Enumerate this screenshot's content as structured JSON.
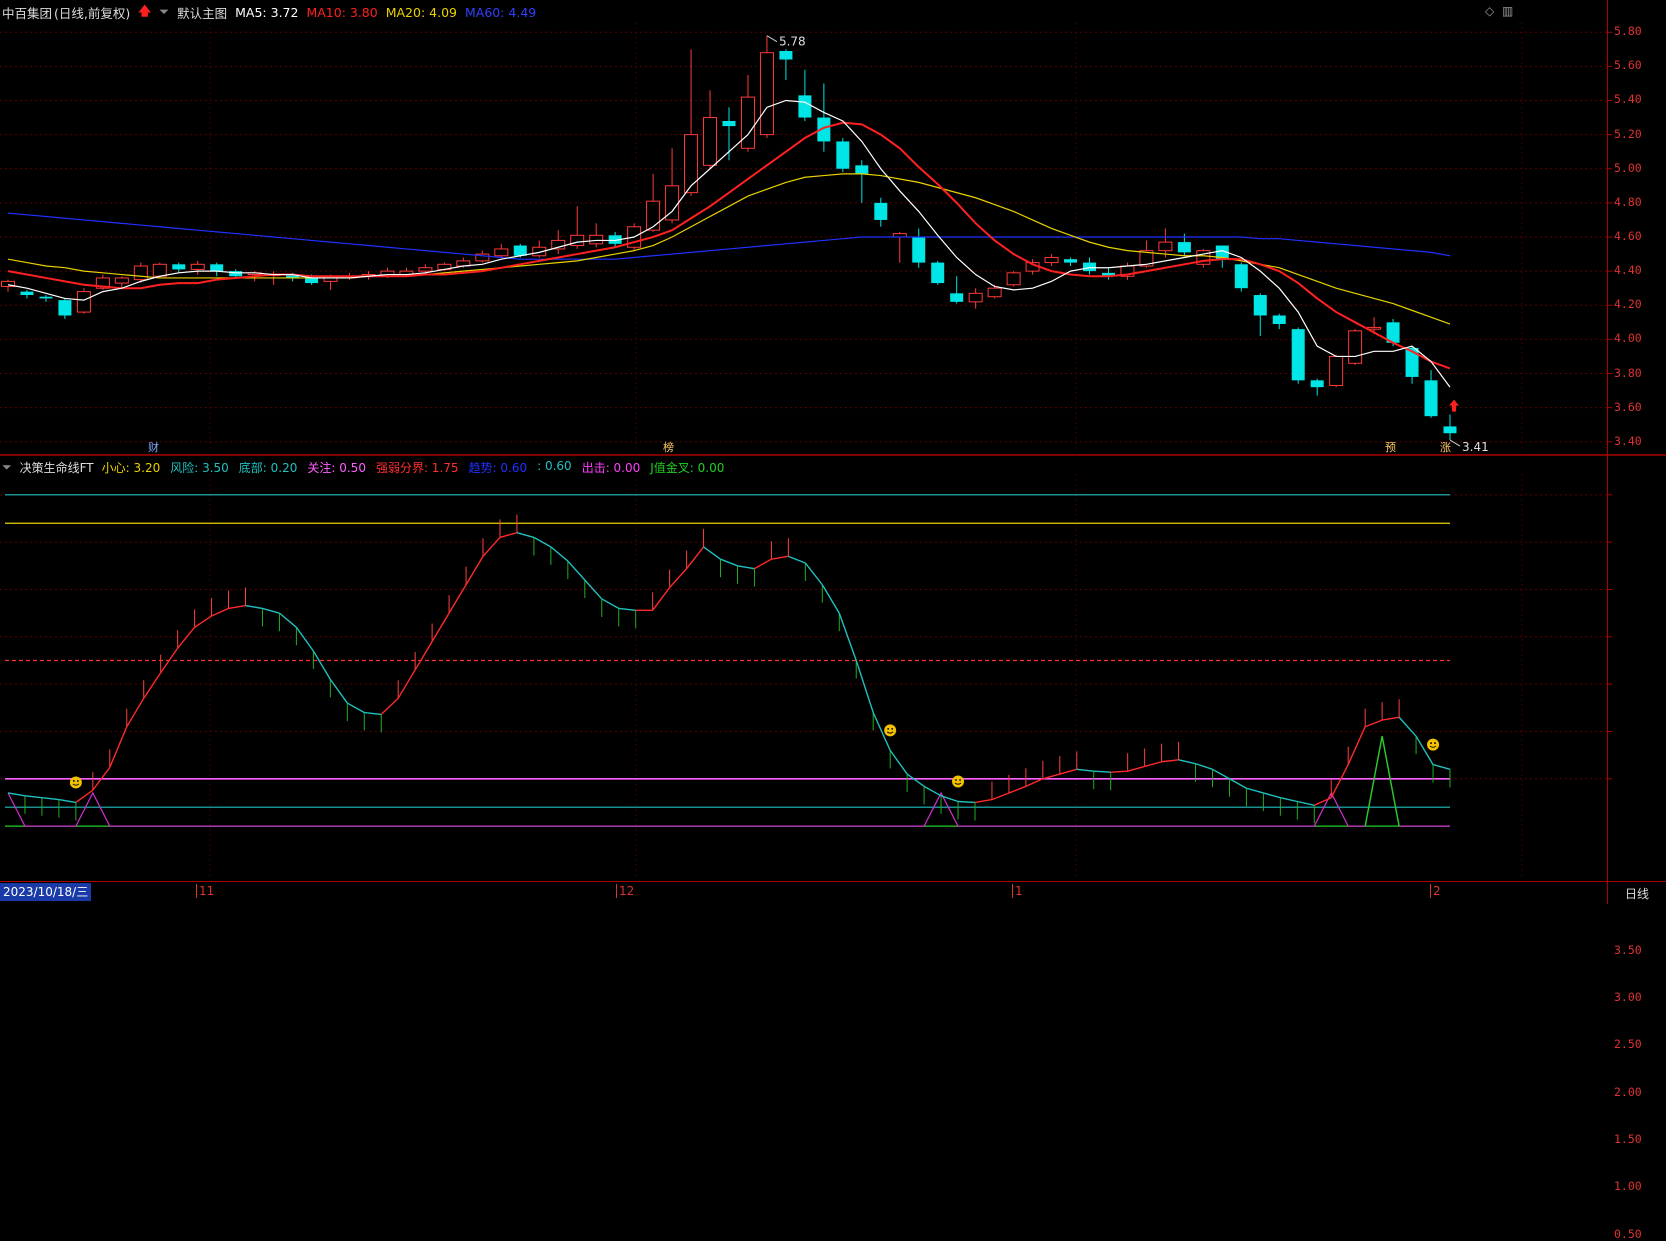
{
  "main_panel": {
    "stock_name": "中百集团",
    "period_label": "(日线,前复权)",
    "template_name": "默认主图",
    "ma5": {
      "label": "MA5: 3.72",
      "color": "#ffffff"
    },
    "ma10": {
      "label": "MA10: 3.80",
      "color": "#ff2020"
    },
    "ma20": {
      "label": "MA20: 4.09",
      "color": "#e8d200"
    },
    "ma60": {
      "label": "MA60: 4.49",
      "color": "#2030ff"
    },
    "y_ticks": [
      "5.80",
      "5.60",
      "5.40",
      "5.20",
      "5.00",
      "4.80",
      "4.60",
      "4.40",
      "4.20",
      "4.00",
      "3.80",
      "3.60",
      "3.40"
    ],
    "high_marker": "5.78",
    "low_marker": "3.41",
    "event_tags": [
      {
        "text": "财",
        "color": "#7aaaff"
      },
      {
        "text": "榜",
        "color": "#ffcc66"
      },
      {
        "text": "预",
        "color": "#ffcc66"
      },
      {
        "text": "涨",
        "color": "#ffcc66"
      }
    ]
  },
  "sub_panel": {
    "indicator_name": "决策生命线FT",
    "params": [
      {
        "label": "小心: 3.20",
        "color": "#e8d200"
      },
      {
        "label": "风险: 3.50",
        "color": "#20c0c0"
      },
      {
        "label": "底部: 0.20",
        "color": "#20c0c0"
      },
      {
        "label": "关注: 0.50",
        "color": "#ff60ff"
      },
      {
        "label": "强弱分界: 1.75",
        "color": "#ff3030"
      },
      {
        "label": "趋势: 0.60",
        "color": "#2030ff"
      },
      {
        "label": ": 0.60",
        "color": "#20c0c0"
      },
      {
        "label": "出击: 0.00",
        "color": "#ff40ff"
      },
      {
        "label": "J值金叉: 0.00",
        "color": "#20d020"
      }
    ],
    "y_ticks": [
      "3.50",
      "3.00",
      "2.50",
      "2.00",
      "1.50",
      "1.00",
      "0.50"
    ]
  },
  "x_axis": {
    "cursor_date": "2023/10/18/三",
    "month_labels": [
      "11",
      "12",
      "1",
      "2"
    ],
    "period_button": "日线"
  },
  "chart_data": [
    {
      "type": "candlestick",
      "ylim": [
        3.35,
        5.85
      ],
      "candles": [
        [
          4.31,
          4.34,
          4.28,
          4.35
        ],
        [
          4.28,
          4.26,
          4.24,
          4.29
        ],
        [
          4.25,
          4.24,
          4.22,
          4.26
        ],
        [
          4.23,
          4.14,
          4.12,
          4.24
        ],
        [
          4.16,
          4.28,
          4.15,
          4.3
        ],
        [
          4.3,
          4.36,
          4.29,
          4.38
        ],
        [
          4.33,
          4.36,
          4.3,
          4.37
        ],
        [
          4.35,
          4.43,
          4.33,
          4.45
        ],
        [
          4.37,
          4.44,
          4.36,
          4.45
        ],
        [
          4.44,
          4.41,
          4.39,
          4.45
        ],
        [
          4.41,
          4.44,
          4.38,
          4.46
        ],
        [
          4.44,
          4.4,
          4.37,
          4.45
        ],
        [
          4.4,
          4.37,
          4.36,
          4.41
        ],
        [
          4.38,
          4.39,
          4.34,
          4.4
        ],
        [
          4.38,
          4.38,
          4.32,
          4.4
        ],
        [
          4.38,
          4.36,
          4.34,
          4.39
        ],
        [
          4.36,
          4.33,
          4.32,
          4.38
        ],
        [
          4.34,
          4.37,
          4.29,
          4.38
        ],
        [
          4.36,
          4.37,
          4.35,
          4.39
        ],
        [
          4.37,
          4.38,
          4.35,
          4.4
        ],
        [
          4.37,
          4.4,
          4.36,
          4.42
        ],
        [
          4.38,
          4.4,
          4.37,
          4.42
        ],
        [
          4.4,
          4.42,
          4.38,
          4.44
        ],
        [
          4.41,
          4.44,
          4.4,
          4.45
        ],
        [
          4.43,
          4.46,
          4.42,
          4.48
        ],
        [
          4.46,
          4.5,
          4.45,
          4.52
        ],
        [
          4.49,
          4.53,
          4.48,
          4.56
        ],
        [
          4.55,
          4.49,
          4.48,
          4.56
        ],
        [
          4.49,
          4.54,
          4.48,
          4.58
        ],
        [
          4.53,
          4.58,
          4.5,
          4.64
        ],
        [
          4.55,
          4.61,
          4.53,
          4.78
        ],
        [
          4.56,
          4.61,
          4.54,
          4.68
        ],
        [
          4.61,
          4.56,
          4.54,
          4.63
        ],
        [
          4.54,
          4.66,
          4.52,
          4.68
        ],
        [
          4.64,
          4.81,
          4.63,
          4.97
        ],
        [
          4.7,
          4.9,
          4.68,
          5.12
        ],
        [
          4.86,
          5.2,
          4.84,
          5.7
        ],
        [
          5.02,
          5.3,
          5.0,
          5.46
        ],
        [
          5.28,
          5.25,
          5.05,
          5.36
        ],
        [
          5.12,
          5.42,
          5.1,
          5.55
        ],
        [
          5.2,
          5.68,
          5.18,
          5.78
        ],
        [
          5.69,
          5.64,
          5.52,
          5.7
        ],
        [
          5.43,
          5.3,
          5.28,
          5.58
        ],
        [
          5.3,
          5.16,
          5.1,
          5.5
        ],
        [
          5.16,
          5.0,
          4.98,
          5.18
        ],
        [
          5.02,
          4.97,
          4.8,
          5.05
        ],
        [
          4.8,
          4.7,
          4.66,
          4.83
        ],
        [
          4.6,
          4.62,
          4.45,
          4.63
        ],
        [
          4.6,
          4.45,
          4.42,
          4.65
        ],
        [
          4.45,
          4.33,
          4.32,
          4.46
        ],
        [
          4.27,
          4.22,
          4.21,
          4.37
        ],
        [
          4.22,
          4.27,
          4.18,
          4.3
        ],
        [
          4.25,
          4.3,
          4.24,
          4.32
        ],
        [
          4.32,
          4.39,
          4.31,
          4.4
        ],
        [
          4.4,
          4.45,
          4.38,
          4.47
        ],
        [
          4.45,
          4.48,
          4.43,
          4.5
        ],
        [
          4.47,
          4.45,
          4.43,
          4.48
        ],
        [
          4.45,
          4.4,
          4.38,
          4.48
        ],
        [
          4.39,
          4.37,
          4.35,
          4.42
        ],
        [
          4.37,
          4.43,
          4.35,
          4.45
        ],
        [
          4.43,
          4.52,
          4.42,
          4.58
        ],
        [
          4.52,
          4.57,
          4.48,
          4.65
        ],
        [
          4.57,
          4.51,
          4.49,
          4.62
        ],
        [
          4.44,
          4.52,
          4.42,
          4.53
        ],
        [
          4.55,
          4.47,
          4.42,
          4.55
        ],
        [
          4.44,
          4.3,
          4.28,
          4.45
        ],
        [
          4.26,
          4.14,
          4.02,
          4.27
        ],
        [
          4.14,
          4.09,
          4.06,
          4.15
        ],
        [
          4.06,
          3.76,
          3.74,
          4.07
        ],
        [
          3.76,
          3.72,
          3.67,
          3.77
        ],
        [
          3.73,
          3.9,
          3.72,
          3.91
        ],
        [
          3.86,
          4.05,
          3.85,
          4.06
        ],
        [
          4.06,
          4.07,
          4.03,
          4.13
        ],
        [
          4.1,
          3.98,
          3.96,
          4.12
        ],
        [
          3.95,
          3.78,
          3.74,
          3.96
        ],
        [
          3.76,
          3.55,
          3.54,
          3.82
        ],
        [
          3.49,
          3.45,
          3.41,
          3.56
        ]
      ],
      "ma5": [
        4.32,
        4.3,
        4.27,
        4.24,
        4.23,
        4.28,
        4.3,
        4.34,
        4.37,
        4.39,
        4.4,
        4.4,
        4.39,
        4.39,
        4.38,
        4.38,
        4.36,
        4.36,
        4.36,
        4.37,
        4.38,
        4.38,
        4.39,
        4.41,
        4.43,
        4.44,
        4.47,
        4.49,
        4.51,
        4.54,
        4.57,
        4.58,
        4.58,
        4.6,
        4.66,
        4.75,
        4.9,
        5.0,
        5.1,
        5.2,
        5.36,
        5.4,
        5.39,
        5.33,
        5.28,
        5.16,
        5.0,
        4.87,
        4.75,
        4.61,
        4.48,
        4.38,
        4.31,
        4.29,
        4.3,
        4.34,
        4.4,
        4.42,
        4.42,
        4.43,
        4.44,
        4.46,
        4.48,
        4.5,
        4.52,
        4.48,
        4.4,
        4.3,
        4.16,
        3.96,
        3.9,
        3.9,
        3.93,
        3.93,
        3.96,
        3.87,
        3.72
      ],
      "ma10": [
        4.4,
        4.38,
        4.36,
        4.34,
        4.32,
        4.31,
        4.3,
        4.3,
        4.32,
        4.33,
        4.33,
        4.35,
        4.36,
        4.37,
        4.38,
        4.38,
        4.37,
        4.37,
        4.37,
        4.37,
        4.37,
        4.37,
        4.38,
        4.38,
        4.39,
        4.4,
        4.42,
        4.44,
        4.46,
        4.48,
        4.5,
        4.52,
        4.54,
        4.57,
        4.6,
        4.64,
        4.71,
        4.78,
        4.86,
        4.94,
        5.02,
        5.1,
        5.18,
        5.24,
        5.27,
        5.26,
        5.2,
        5.12,
        5.01,
        4.91,
        4.8,
        4.68,
        4.58,
        4.5,
        4.44,
        4.4,
        4.38,
        4.37,
        4.37,
        4.38,
        4.4,
        4.42,
        4.44,
        4.46,
        4.47,
        4.47,
        4.44,
        4.4,
        4.33,
        4.24,
        4.16,
        4.1,
        4.04,
        3.98,
        3.93,
        3.87,
        3.83
      ],
      "ma20": [
        4.47,
        4.45,
        4.43,
        4.42,
        4.4,
        4.39,
        4.38,
        4.37,
        4.36,
        4.36,
        4.36,
        4.36,
        4.36,
        4.36,
        4.36,
        4.36,
        4.36,
        4.36,
        4.36,
        4.37,
        4.37,
        4.37,
        4.38,
        4.39,
        4.4,
        4.41,
        4.42,
        4.43,
        4.44,
        4.45,
        4.46,
        4.48,
        4.5,
        4.52,
        4.55,
        4.6,
        4.66,
        4.72,
        4.78,
        4.84,
        4.88,
        4.92,
        4.95,
        4.96,
        4.97,
        4.97,
        4.96,
        4.94,
        4.92,
        4.89,
        4.86,
        4.83,
        4.79,
        4.75,
        4.7,
        4.65,
        4.61,
        4.57,
        4.54,
        4.52,
        4.51,
        4.5,
        4.49,
        4.49,
        4.48,
        4.46,
        4.44,
        4.42,
        4.38,
        4.34,
        4.3,
        4.27,
        4.24,
        4.21,
        4.17,
        4.13,
        4.09
      ],
      "ma60": [
        4.74,
        4.73,
        4.72,
        4.71,
        4.7,
        4.69,
        4.68,
        4.67,
        4.66,
        4.65,
        4.64,
        4.63,
        4.62,
        4.61,
        4.6,
        4.59,
        4.58,
        4.57,
        4.56,
        4.55,
        4.54,
        4.53,
        4.52,
        4.51,
        4.5,
        4.49,
        4.48,
        4.47,
        4.47,
        4.47,
        4.47,
        4.47,
        4.47,
        4.48,
        4.49,
        4.5,
        4.51,
        4.52,
        4.53,
        4.54,
        4.55,
        4.56,
        4.57,
        4.58,
        4.59,
        4.6,
        4.6,
        4.6,
        4.6,
        4.6,
        4.6,
        4.6,
        4.6,
        4.6,
        4.6,
        4.6,
        4.6,
        4.6,
        4.6,
        4.6,
        4.6,
        4.6,
        4.6,
        4.6,
        4.6,
        4.6,
        4.59,
        4.59,
        4.58,
        4.57,
        4.56,
        4.55,
        4.54,
        4.53,
        4.52,
        4.51,
        4.49
      ]
    },
    {
      "type": "line",
      "ylim": [
        0,
        3.8
      ],
      "hlines": [
        {
          "value": 3.5,
          "color": "#20c0c0"
        },
        {
          "value": 3.2,
          "color": "#e8d200"
        },
        {
          "value": 1.75,
          "color": "#ff3030",
          "dashed": true
        },
        {
          "value": 0.5,
          "color": "#ff60ff"
        },
        {
          "value": 0.2,
          "color": "#20c0c0"
        },
        {
          "value": 0.0,
          "color": "#20d020"
        }
      ],
      "lifeline": [
        0.35,
        0.32,
        0.3,
        0.28,
        0.25,
        0.38,
        0.62,
        1.05,
        1.35,
        1.62,
        1.88,
        2.1,
        2.22,
        2.3,
        2.33,
        2.3,
        2.25,
        2.1,
        1.85,
        1.55,
        1.3,
        1.2,
        1.18,
        1.35,
        1.65,
        1.95,
        2.25,
        2.55,
        2.85,
        3.05,
        3.1,
        3.05,
        2.95,
        2.8,
        2.6,
        2.4,
        2.3,
        2.28,
        2.28,
        2.52,
        2.72,
        2.95,
        2.82,
        2.75,
        2.72,
        2.82,
        2.85,
        2.78,
        2.55,
        2.25,
        1.75,
        1.2,
        0.8,
        0.55,
        0.42,
        0.32,
        0.26,
        0.25,
        0.28,
        0.35,
        0.42,
        0.5,
        0.55,
        0.6,
        0.58,
        0.57,
        0.58,
        0.63,
        0.68,
        0.7,
        0.66,
        0.6,
        0.5,
        0.4,
        0.35,
        0.3,
        0.26,
        0.22,
        0.3,
        0.65,
        1.05,
        1.12,
        1.15,
        0.95,
        0.65,
        0.6
      ],
      "signal": [
        0.35,
        0,
        0,
        0,
        0,
        0.35,
        0,
        0,
        0,
        0,
        0,
        0,
        0,
        0,
        0,
        0,
        0,
        0,
        0,
        0,
        0,
        0,
        0,
        0,
        0,
        0,
        0,
        0,
        0,
        0,
        0,
        0,
        0,
        0,
        0,
        0,
        0,
        0,
        0,
        0,
        0,
        0,
        0,
        0,
        0,
        0,
        0,
        0,
        0,
        0,
        0,
        0,
        0,
        0,
        0,
        0.35,
        0,
        0,
        0,
        0,
        0,
        0,
        0,
        0,
        0,
        0,
        0,
        0,
        0,
        0,
        0,
        0,
        0,
        0,
        0,
        0,
        0,
        0,
        0.35,
        0,
        0,
        0.95,
        0,
        0,
        0,
        0
      ],
      "smiley_index": [
        4,
        52,
        56,
        84
      ]
    }
  ]
}
